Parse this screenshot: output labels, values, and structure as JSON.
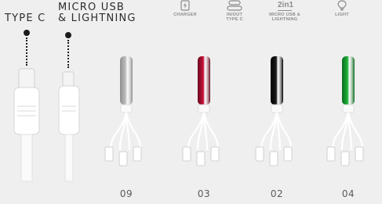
{
  "labels": {
    "type_c": "TYPE C",
    "micro_line1": "MICRO USB",
    "micro_line2": "& LIGHTNING"
  },
  "features": [
    {
      "icon": "charger-icon",
      "line1": "CHARGER",
      "line2": ""
    },
    {
      "icon": "usb-c-port-icon",
      "line1": "IN/OUT",
      "line2": "TYPE C"
    },
    {
      "icon": "two-in-one-icon",
      "line1": "MICRO USB &",
      "line2": "LIGHTNING",
      "glyph": "2in1"
    },
    {
      "icon": "light-bulb-icon",
      "line1": "LIGHT",
      "line2": ""
    }
  ],
  "variants": [
    {
      "code": "09",
      "color": "#bfbfbf",
      "accent": "#8f8f8f"
    },
    {
      "code": "03",
      "color": "#c8103a",
      "accent": "#6a0a1f"
    },
    {
      "code": "02",
      "color": "#1a1a1a",
      "accent": "#000000"
    },
    {
      "code": "04",
      "color": "#1fb33a",
      "accent": "#0a6a1c"
    }
  ],
  "colors": {
    "background": "#efefef",
    "icon_gray": "#8c8c8c",
    "connector_white": "#ffffff"
  }
}
